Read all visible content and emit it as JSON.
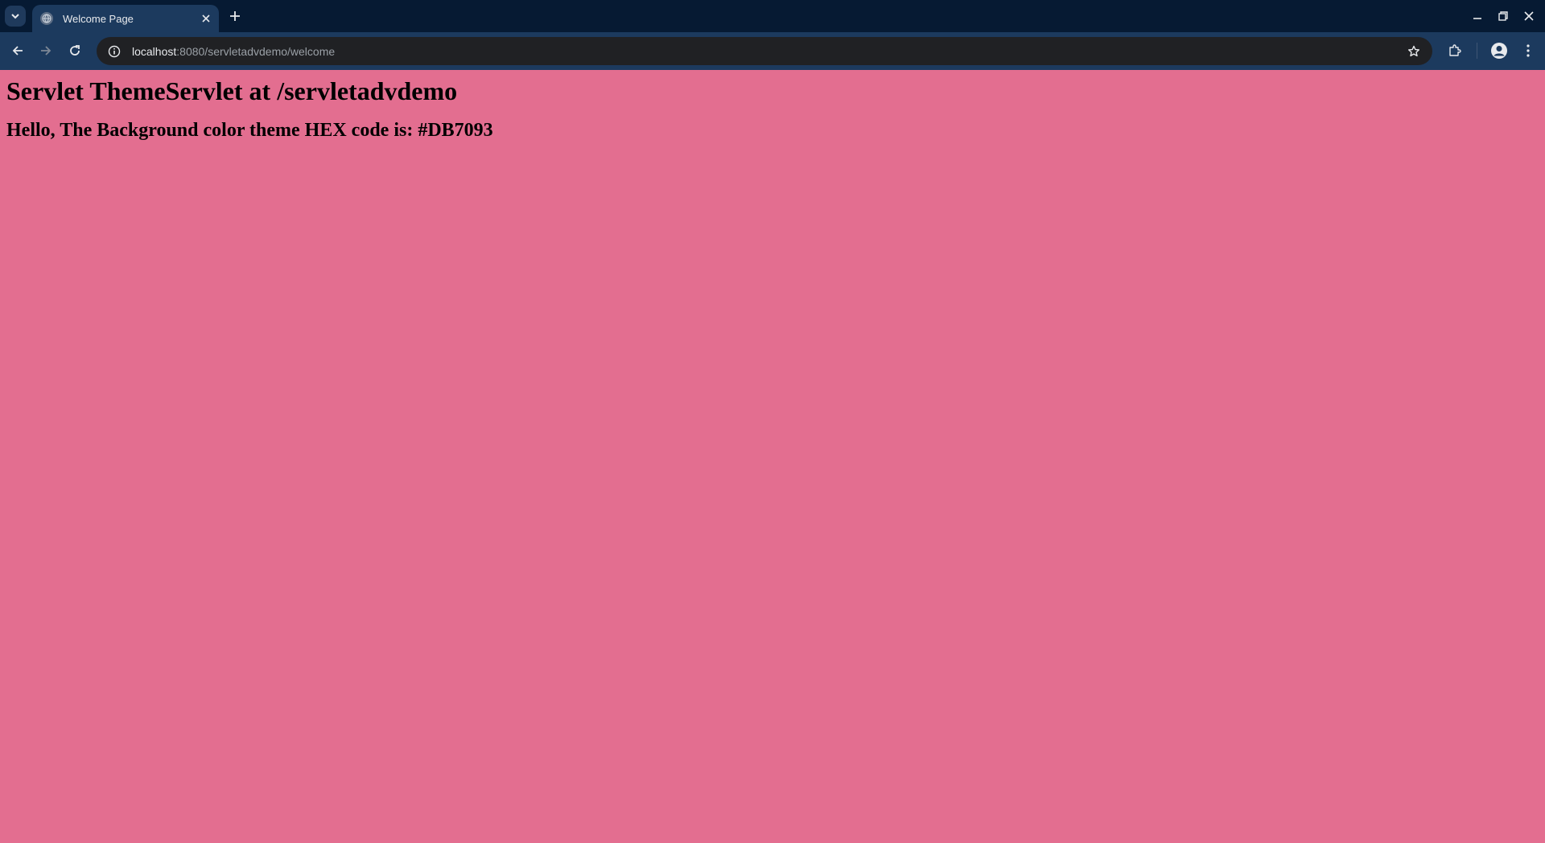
{
  "browser": {
    "tab": {
      "title": "Welcome Page"
    },
    "address": {
      "host": "localhost",
      "rest": ":8080/servletadvdemo/welcome"
    }
  },
  "page": {
    "heading": "Servlet ThemeServlet at /servletadvdemo",
    "message": "Hello, The Background color theme HEX code is: #DB7093"
  },
  "colors": {
    "page_background": "#e36e90",
    "tabstrip": "#061a33",
    "toolbar": "#1c3a5e",
    "omnibox": "#202124"
  },
  "icons": [
    "tab-search-icon",
    "globe-icon",
    "close-icon",
    "plus-icon",
    "minimize-icon",
    "restore-icon",
    "window-close-icon",
    "back-arrow-icon",
    "forward-arrow-icon",
    "reload-icon",
    "site-info-icon",
    "star-icon",
    "extensions-icon",
    "profile-icon",
    "kebab-menu-icon"
  ]
}
